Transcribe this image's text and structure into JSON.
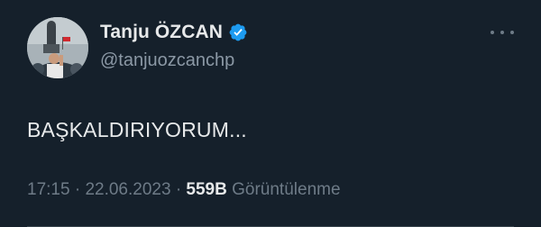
{
  "author": {
    "display_name": "Tanju ÖZCAN",
    "handle": "@tanjuozcanchp",
    "verified_icon": "verified-badge-icon",
    "avatar_icon": "profile-avatar"
  },
  "tweet": {
    "text": "BAŞKALDIRIYORUM..."
  },
  "meta": {
    "time": "17:15",
    "separator": "·",
    "date": "22.06.2023",
    "views_count": "559B",
    "views_label": "Görüntülenme"
  },
  "menu": {
    "icon": "more-options-icon"
  },
  "colors": {
    "background": "#15202b",
    "primary_text": "#e7e9ea",
    "secondary_text": "#8b98a5",
    "verified": "#1d9bf0"
  }
}
